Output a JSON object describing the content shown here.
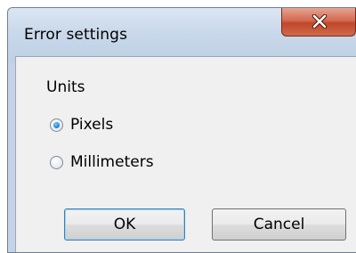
{
  "window": {
    "title": "Error settings",
    "close_icon": "close-icon"
  },
  "units": {
    "label": "Units",
    "options": [
      {
        "label": "Pixels",
        "checked": true
      },
      {
        "label": "Millimeters",
        "checked": false
      }
    ]
  },
  "buttons": {
    "ok_label": "OK",
    "cancel_label": "Cancel"
  },
  "colors": {
    "close_button": "#c0472a",
    "titlebar": "#c9d8ea",
    "client_bg": "#f0f0f0",
    "radio_selected": "#2a8ad8"
  }
}
